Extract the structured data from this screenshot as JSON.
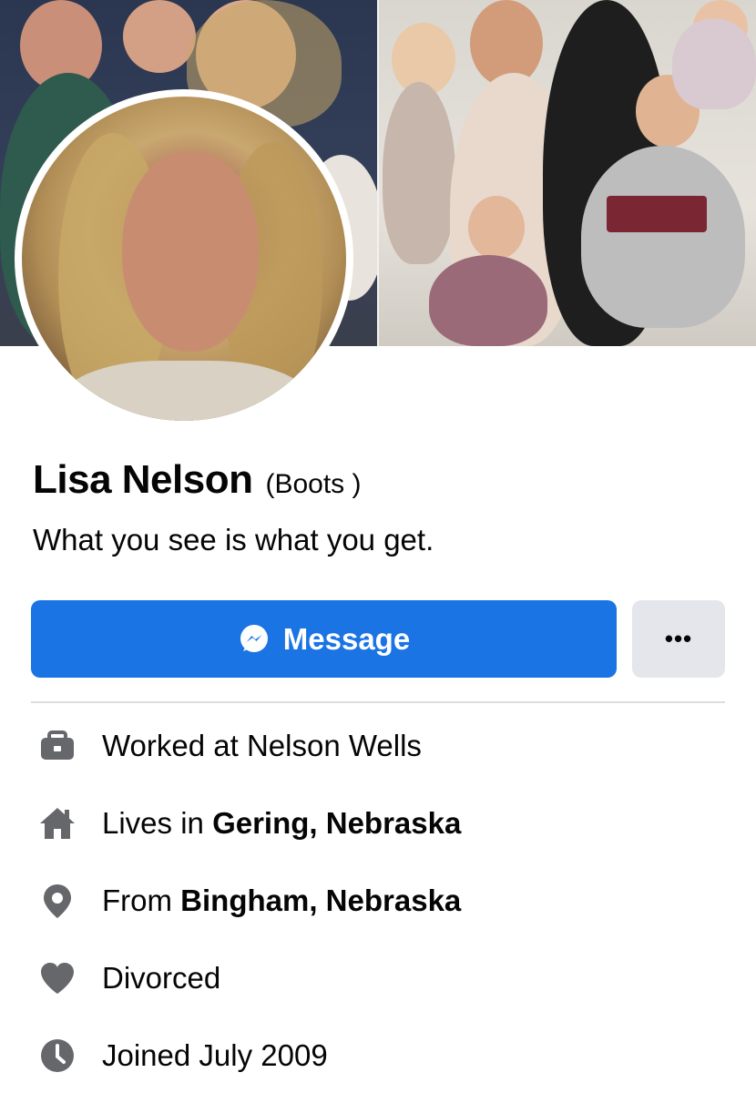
{
  "profile": {
    "name": "Lisa Nelson",
    "nickname": "(Boots )",
    "bio": "What you see is what you get."
  },
  "actions": {
    "message_label": "Message",
    "more_label": "•••"
  },
  "intro": {
    "work": {
      "prefix": "Worked at Nelson Wells",
      "icon": "briefcase-icon"
    },
    "lives": {
      "prefix": "Lives in ",
      "place": "Gering, Nebraska",
      "icon": "home-icon"
    },
    "from": {
      "prefix": "From ",
      "place": "Bingham, Nebraska",
      "icon": "location-pin-icon"
    },
    "relationship": {
      "prefix": "Divorced",
      "icon": "heart-icon"
    },
    "joined": {
      "prefix": "Joined July 2009",
      "icon": "clock-icon"
    }
  },
  "colors": {
    "primary": "#1b74e4",
    "secondary_button": "#e4e6eb",
    "icon_gray": "#65676b",
    "divider": "#dadde1"
  }
}
